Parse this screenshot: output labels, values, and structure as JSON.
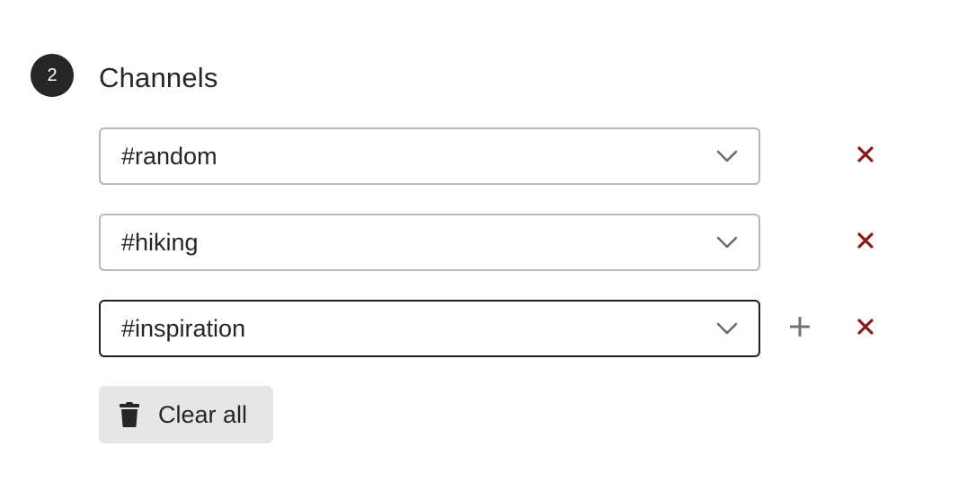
{
  "section": {
    "step_number": "2",
    "title": "Channels"
  },
  "channels": [
    {
      "value": "#random",
      "focused": false,
      "show_add": false
    },
    {
      "value": "#hiking",
      "focused": false,
      "show_add": false
    },
    {
      "value": "#inspiration",
      "focused": true,
      "show_add": true
    }
  ],
  "actions": {
    "clear_all_label": "Clear all"
  },
  "icons": {
    "chevron": "chevron-down-icon",
    "add": "plus-icon",
    "remove": "close-icon",
    "clear": "trash-icon"
  },
  "colors": {
    "badge_bg": "#262626",
    "remove_red": "#8a1a1a",
    "focused_border": "#1f1f1f",
    "default_border": "#b8b8b8",
    "clear_bg": "#e6e6e6"
  }
}
